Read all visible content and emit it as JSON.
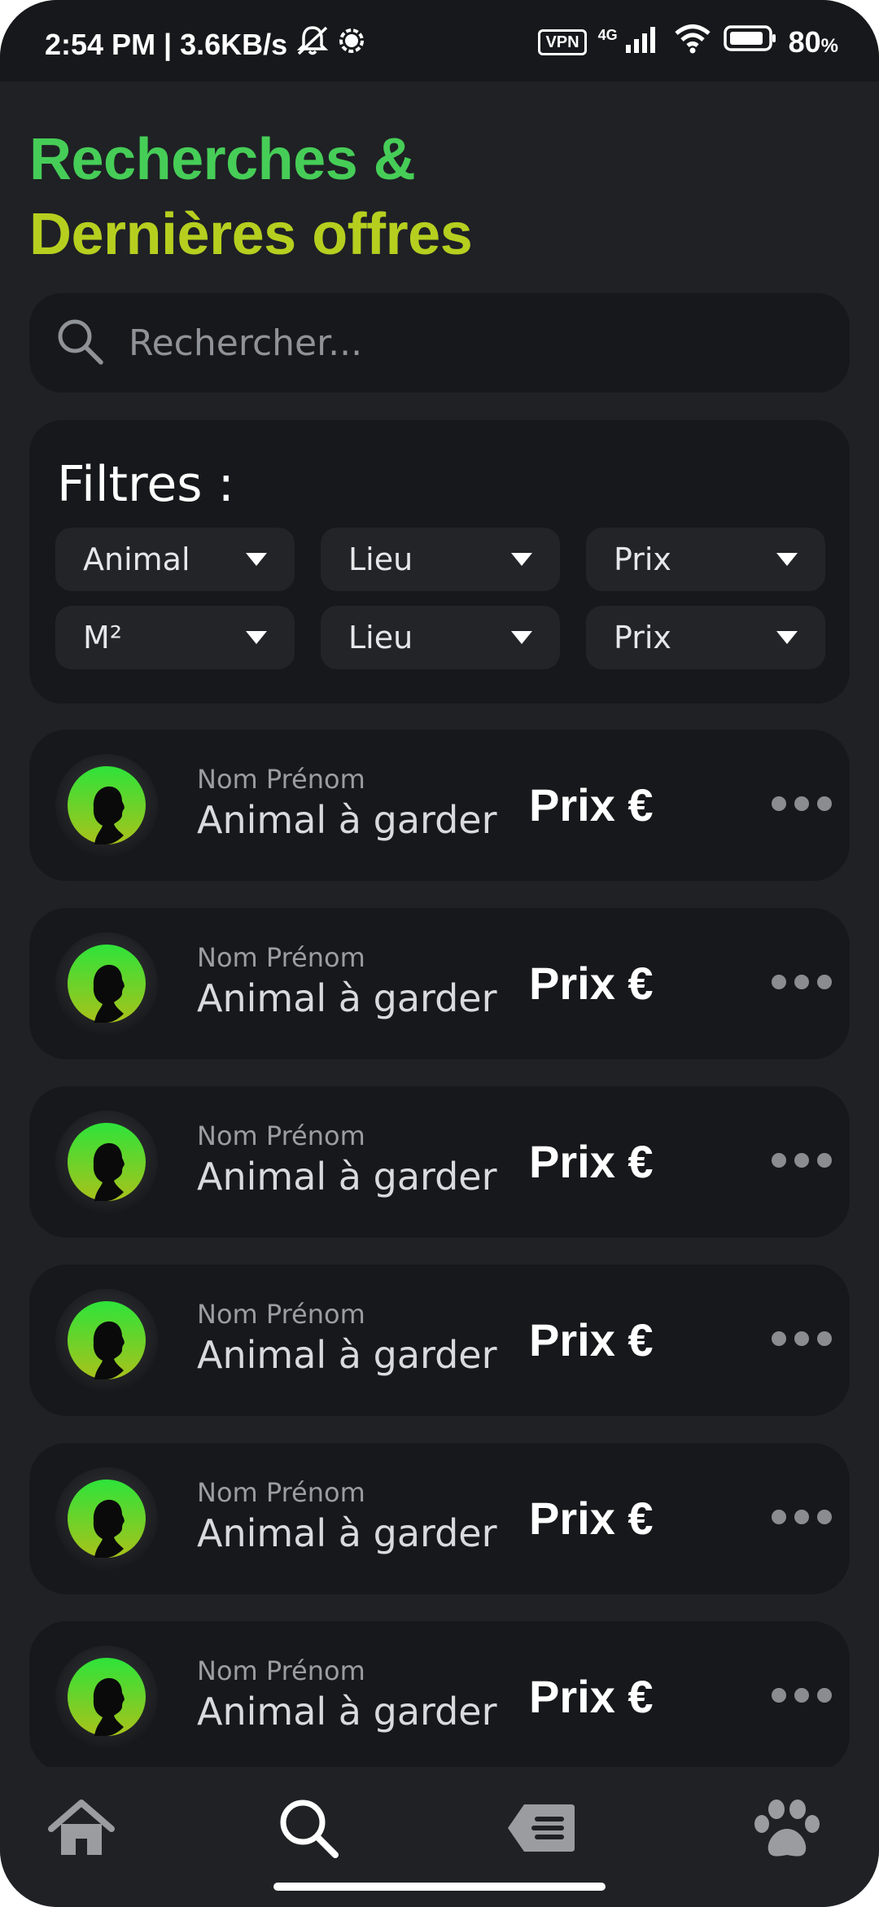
{
  "status_bar": {
    "time": "2:54 PM | 3.6KB/s",
    "vpn": "VPN",
    "network": "4G",
    "battery": "80",
    "battery_unit": "%"
  },
  "header": {
    "title_line1": "Recherches &",
    "title_line2": "Dernières offres"
  },
  "search": {
    "placeholder": "Rechercher..."
  },
  "filters": {
    "title": "Filtres :",
    "chips": [
      "Animal",
      "Lieu",
      "Prix",
      "M²",
      "Lieu",
      "Prix"
    ]
  },
  "listings": [
    {
      "name": "Nom Prénom",
      "animal": "Animal à garder",
      "price": "Prix €"
    },
    {
      "name": "Nom Prénom",
      "animal": "Animal à garder",
      "price": "Prix €"
    },
    {
      "name": "Nom Prénom",
      "animal": "Animal à garder",
      "price": "Prix €"
    },
    {
      "name": "Nom Prénom",
      "animal": "Animal à garder",
      "price": "Prix €"
    },
    {
      "name": "Nom Prénom",
      "animal": "Animal à garder",
      "price": "Prix €"
    },
    {
      "name": "Nom Prénom",
      "animal": "Animal à garder",
      "price": "Prix €"
    }
  ],
  "bottom_nav": [
    "home-icon",
    "search-icon",
    "offers-tag-icon",
    "paw-icon"
  ],
  "colors": {
    "title_green": "#46cd57",
    "title_yellow": "#b6cf1f",
    "background": "#1f2125",
    "card": "#17181b"
  }
}
